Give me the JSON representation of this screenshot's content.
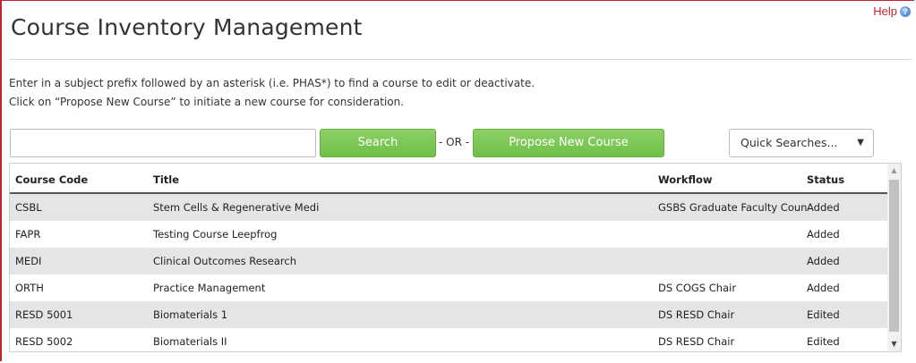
{
  "header": {
    "title": "Course Inventory Management",
    "help_label": "Help"
  },
  "instructions": {
    "line1": "Enter in a subject prefix followed by an asterisk (i.e. PHAS*) to find a course to edit or deactivate.",
    "line2": "Click on “Propose New Course” to initiate a new course for consideration."
  },
  "search": {
    "value": "",
    "button_label": "Search",
    "or_label": "- OR -",
    "propose_label": "Propose New Course"
  },
  "quick_searches": {
    "selected": "Quick Searches..."
  },
  "table": {
    "columns": {
      "code": "Course Code",
      "title": "Title",
      "workflow": "Workflow",
      "status": "Status"
    },
    "rows": [
      {
        "code": "CSBL",
        "title": "Stem Cells & Regenerative Medi",
        "workflow": "GSBS Graduate Faculty Coun",
        "status": "Added"
      },
      {
        "code": "FAPR",
        "title": "Testing Course Leepfrog",
        "workflow": "",
        "status": "Added"
      },
      {
        "code": "MEDI",
        "title": "Clinical Outcomes Research",
        "workflow": "",
        "status": "Added"
      },
      {
        "code": "ORTH",
        "title": "Practice Management",
        "workflow": "DS COGS Chair",
        "status": "Added"
      },
      {
        "code": "RESD 5001",
        "title": "Biomaterials 1",
        "workflow": "DS RESD Chair",
        "status": "Edited"
      },
      {
        "code": "RESD 5002",
        "title": "Biomaterials II",
        "workflow": "DS RESD Chair",
        "status": "Edited"
      }
    ]
  },
  "icons": {
    "help": "help-circle-icon",
    "dropdown": "caret-down-icon"
  }
}
